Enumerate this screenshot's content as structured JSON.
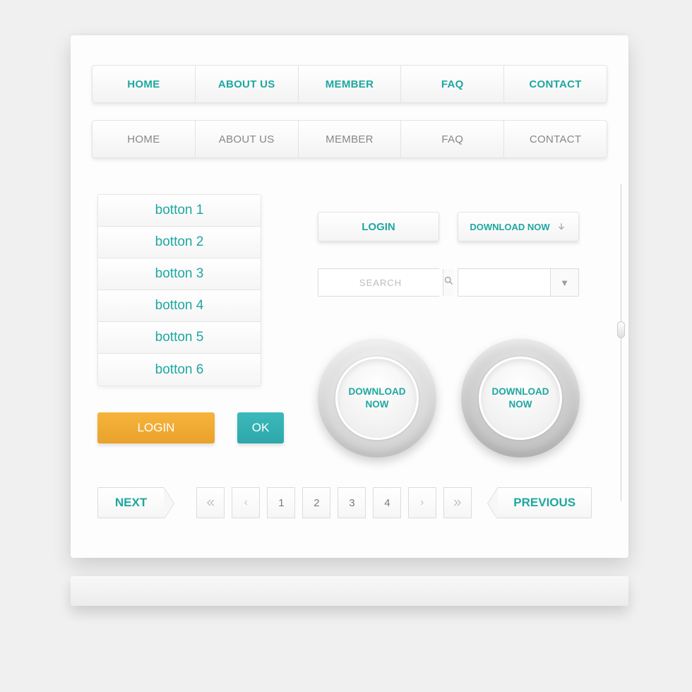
{
  "nav_primary": [
    "HOME",
    "ABOUT US",
    "MEMBER",
    "FAQ",
    "CONTACT"
  ],
  "nav_secondary": [
    "HOME",
    "ABOUT US",
    "MEMBER",
    "FAQ",
    "CONTACT"
  ],
  "vbuttons": [
    "botton 1",
    "botton 2",
    "botton 3",
    "botton 4",
    "botton 5",
    "botton 6"
  ],
  "login_btn": "LOGIN",
  "download_btn": "DOWNLOAD NOW",
  "search_placeholder": "SEARCH",
  "dropdown_value": "",
  "round_download_1": "DOWNLOAD\nNOW",
  "round_download_2": "DOWNLOAD\nNOW",
  "orange_login": "LOGIN",
  "teal_ok": "OK",
  "next_label": "NEXT",
  "prev_label": "PREVIOUS",
  "page_numbers": [
    "1",
    "2",
    "3",
    "4"
  ],
  "colors": {
    "teal": "#1ea7a0",
    "orange": "#eaa633"
  }
}
